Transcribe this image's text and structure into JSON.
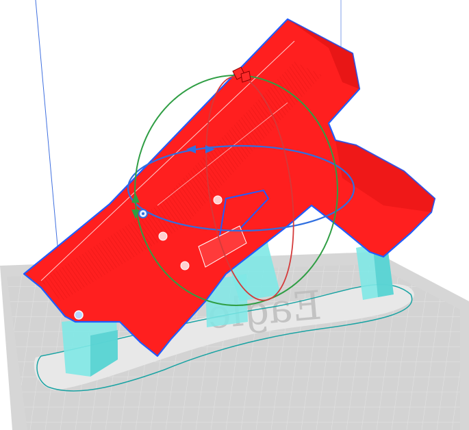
{
  "viewport": {
    "colors": {
      "background": "#ffffff",
      "build_plate": "#d6d6d6",
      "build_plate_edge": "#c8c8c8",
      "grid_line": "#f4f4f4",
      "axis_line": "#3f6fe0",
      "model": "#ff1f1f",
      "model_shade": "#d81010",
      "model_outline": "#1f5cff",
      "support": "#7fe8e6",
      "support_shade": "#52cfcf",
      "brim_line": "#1aa3a3",
      "rotate_x_ring": "#d43a3a",
      "rotate_y_ring": "#2f9e44",
      "rotate_z_ring": "#2f6fe0"
    },
    "plate_logo_text": "Eagle",
    "gizmo": {
      "handles": [
        "rotate-x-handle-icon",
        "rotate-y-handle-icon",
        "rotate-z-handle-icon",
        "pivot-center-icon"
      ]
    }
  }
}
